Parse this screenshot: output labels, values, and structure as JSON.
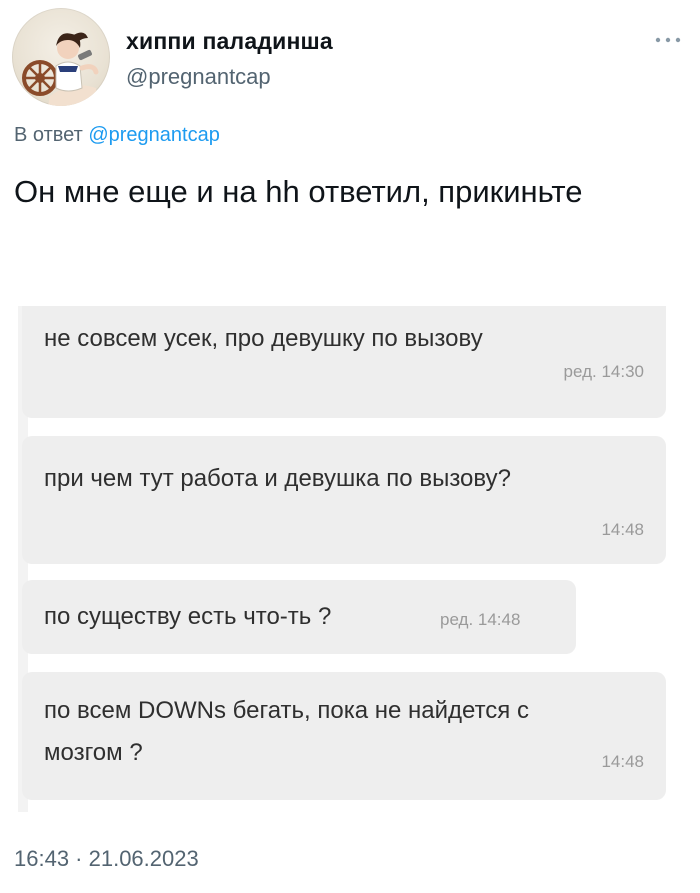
{
  "author": {
    "display_name": "хиппи паладинша",
    "handle": "@pregnantcap"
  },
  "reply": {
    "prefix": "В ответ",
    "mention": "@pregnantcap"
  },
  "tweet": {
    "text": "Он мне еще и на hh ответил, прикиньте",
    "timestamp": "16:43 · 21.06.2023"
  },
  "icons": {
    "more": "more-horizontal-icon",
    "avatar": "avatar-image"
  },
  "screenshot": {
    "messages": [
      {
        "text": "не совсем усек, про девушку по вызову",
        "meta": "ред. 14:30"
      },
      {
        "text": "при чем тут работа и девушка по вызову?",
        "meta": "14:48"
      },
      {
        "text": "по существу есть что-ть ?",
        "meta": "ред. 14:48"
      },
      {
        "text": "по всем DOWNs бегать, пока не найдется с мозгом ?",
        "meta": "14:48"
      }
    ]
  },
  "colors": {
    "link": "#1d9bf0",
    "secondary_text": "#536471",
    "bubble": "#eeeeee"
  }
}
